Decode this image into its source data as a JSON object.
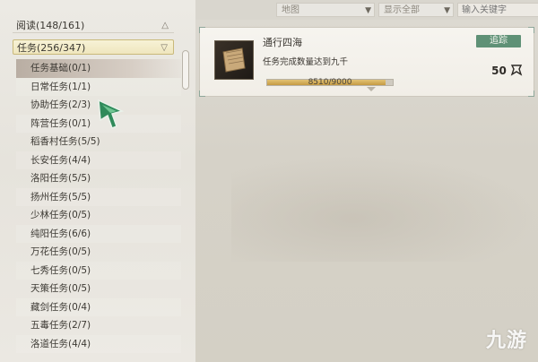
{
  "sidebar": {
    "categories": [
      {
        "label": "阅读(148/161)",
        "arrow": "△"
      },
      {
        "label": "任务(256/347)",
        "arrow": "▽"
      }
    ],
    "items": [
      "任务基础(0/1)",
      "日常任务(1/1)",
      "协助任务(2/3)",
      "阵营任务(0/1)",
      "稻香村任务(5/5)",
      "长安任务(4/4)",
      "洛阳任务(5/5)",
      "扬州任务(5/5)",
      "少林任务(0/5)",
      "纯阳任务(6/6)",
      "万花任务(0/5)",
      "七秀任务(0/5)",
      "天策任务(0/5)",
      "藏剑任务(0/4)",
      "五毒任务(2/7)",
      "洛道任务(4/4)"
    ],
    "selected_index": 0
  },
  "toolbar": {
    "map_label": "地图",
    "filter_label": "显示全部",
    "search_placeholder": "输入关键字"
  },
  "card": {
    "title": "通行四海",
    "description": "任务完成数量达到九千",
    "track_label": "追踪",
    "reward": "50",
    "progress_text": "8510/9000",
    "progress_value": 0.9456
  },
  "watermark": "九游",
  "colors": {
    "accent": "#5f9176",
    "progress": "#d2aa55",
    "selected_row": "#c2b8ad"
  }
}
